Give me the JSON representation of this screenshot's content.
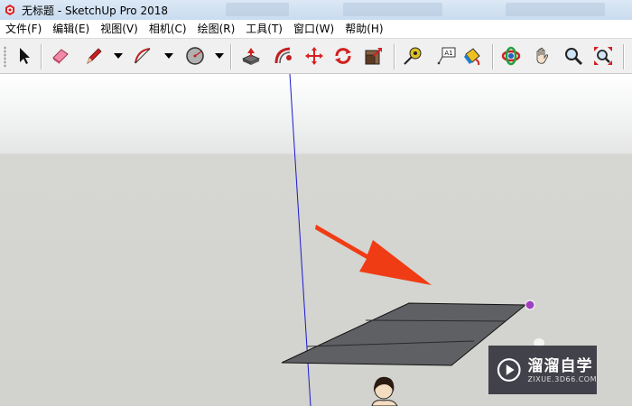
{
  "window": {
    "title": "无标题 - SketchUp Pro 2018",
    "app_icon": "sketchup-logo-icon"
  },
  "menu": [
    {
      "label": "文件(F)"
    },
    {
      "label": "编辑(E)"
    },
    {
      "label": "视图(V)"
    },
    {
      "label": "相机(C)"
    },
    {
      "label": "绘图(R)"
    },
    {
      "label": "工具(T)"
    },
    {
      "label": "窗口(W)"
    },
    {
      "label": "帮助(H)"
    }
  ],
  "toolbar": {
    "tools": [
      {
        "icon": "select-arrow-icon"
      },
      {
        "icon": "eraser-icon"
      },
      {
        "icon": "pencil-line-icon"
      },
      {
        "icon": "arc-icon"
      },
      {
        "icon": "circle-icon"
      },
      {
        "icon": "push-pull-icon"
      },
      {
        "icon": "follow-me-icon"
      },
      {
        "icon": "move-icon"
      },
      {
        "icon": "rotate-icon"
      },
      {
        "icon": "scale-icon"
      },
      {
        "icon": "tape-measure-icon"
      },
      {
        "icon": "text-label-icon"
      },
      {
        "icon": "paint-bucket-icon"
      },
      {
        "icon": "orbit-icon"
      },
      {
        "icon": "pan-hand-icon"
      },
      {
        "icon": "zoom-icon"
      },
      {
        "icon": "zoom-extents-icon"
      }
    ],
    "text_tool_label": "A1"
  },
  "viewport": {
    "sky_color": "#ffffff",
    "ground_color": "#d2d2ce",
    "face_color": "#5f6064",
    "axis_color": "#1a1ad0",
    "annotation_arrow_color": "#f03c14",
    "endpoint_color": "#a040c0"
  },
  "watermark": {
    "name": "溜溜自学",
    "url": "ZIXUE.3D66.COM"
  }
}
